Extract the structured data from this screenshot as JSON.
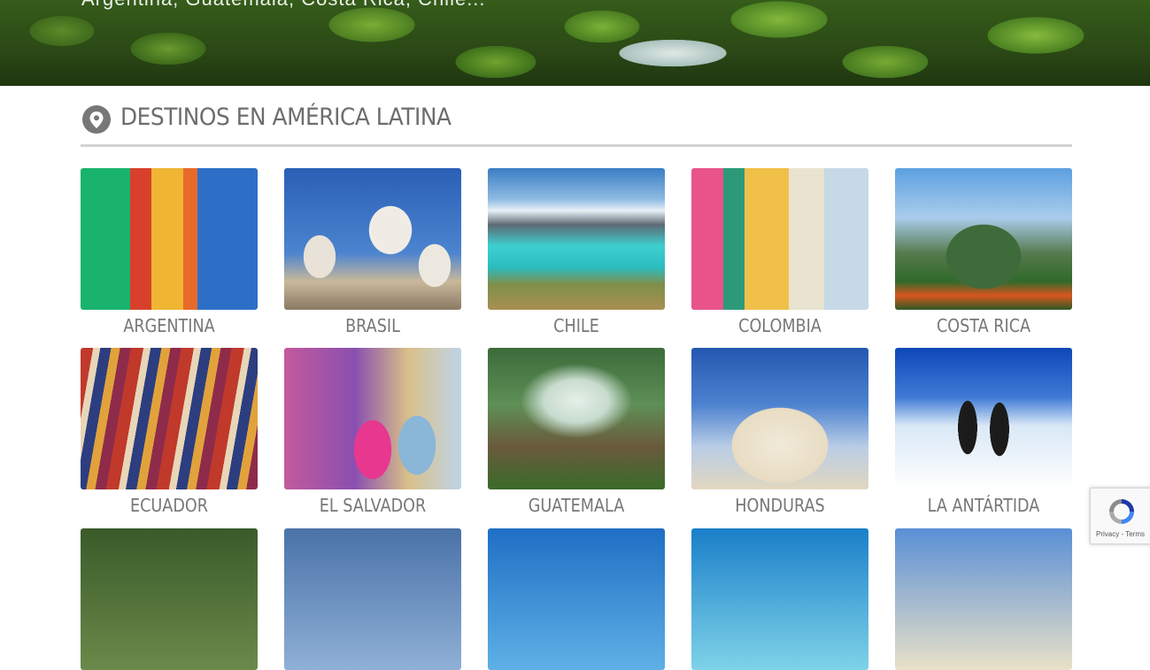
{
  "hero": {
    "caption": "Argentina, Guatemala, Costa Rica, Chile..."
  },
  "section": {
    "title": "DESTINOS EN AMÉRICA LATINA"
  },
  "destinations": [
    {
      "name": "ARGENTINA"
    },
    {
      "name": "BRASIL"
    },
    {
      "name": "CHILE"
    },
    {
      "name": "COLOMBIA"
    },
    {
      "name": "COSTA RICA"
    },
    {
      "name": "ECUADOR"
    },
    {
      "name": "EL SALVADOR"
    },
    {
      "name": "GUATEMALA"
    },
    {
      "name": "HONDURAS"
    },
    {
      "name": "LA ANTÁRTIDA"
    }
  ],
  "recaptcha": {
    "privacy": "Privacy",
    "separator": " - ",
    "terms": "Terms"
  },
  "colors": {
    "heading": "#6d6d6d",
    "label": "#777777",
    "rule": "#d3d3d3"
  },
  "icons": {
    "section": "map-pin-icon",
    "captcha": "recaptcha-logo-icon"
  }
}
